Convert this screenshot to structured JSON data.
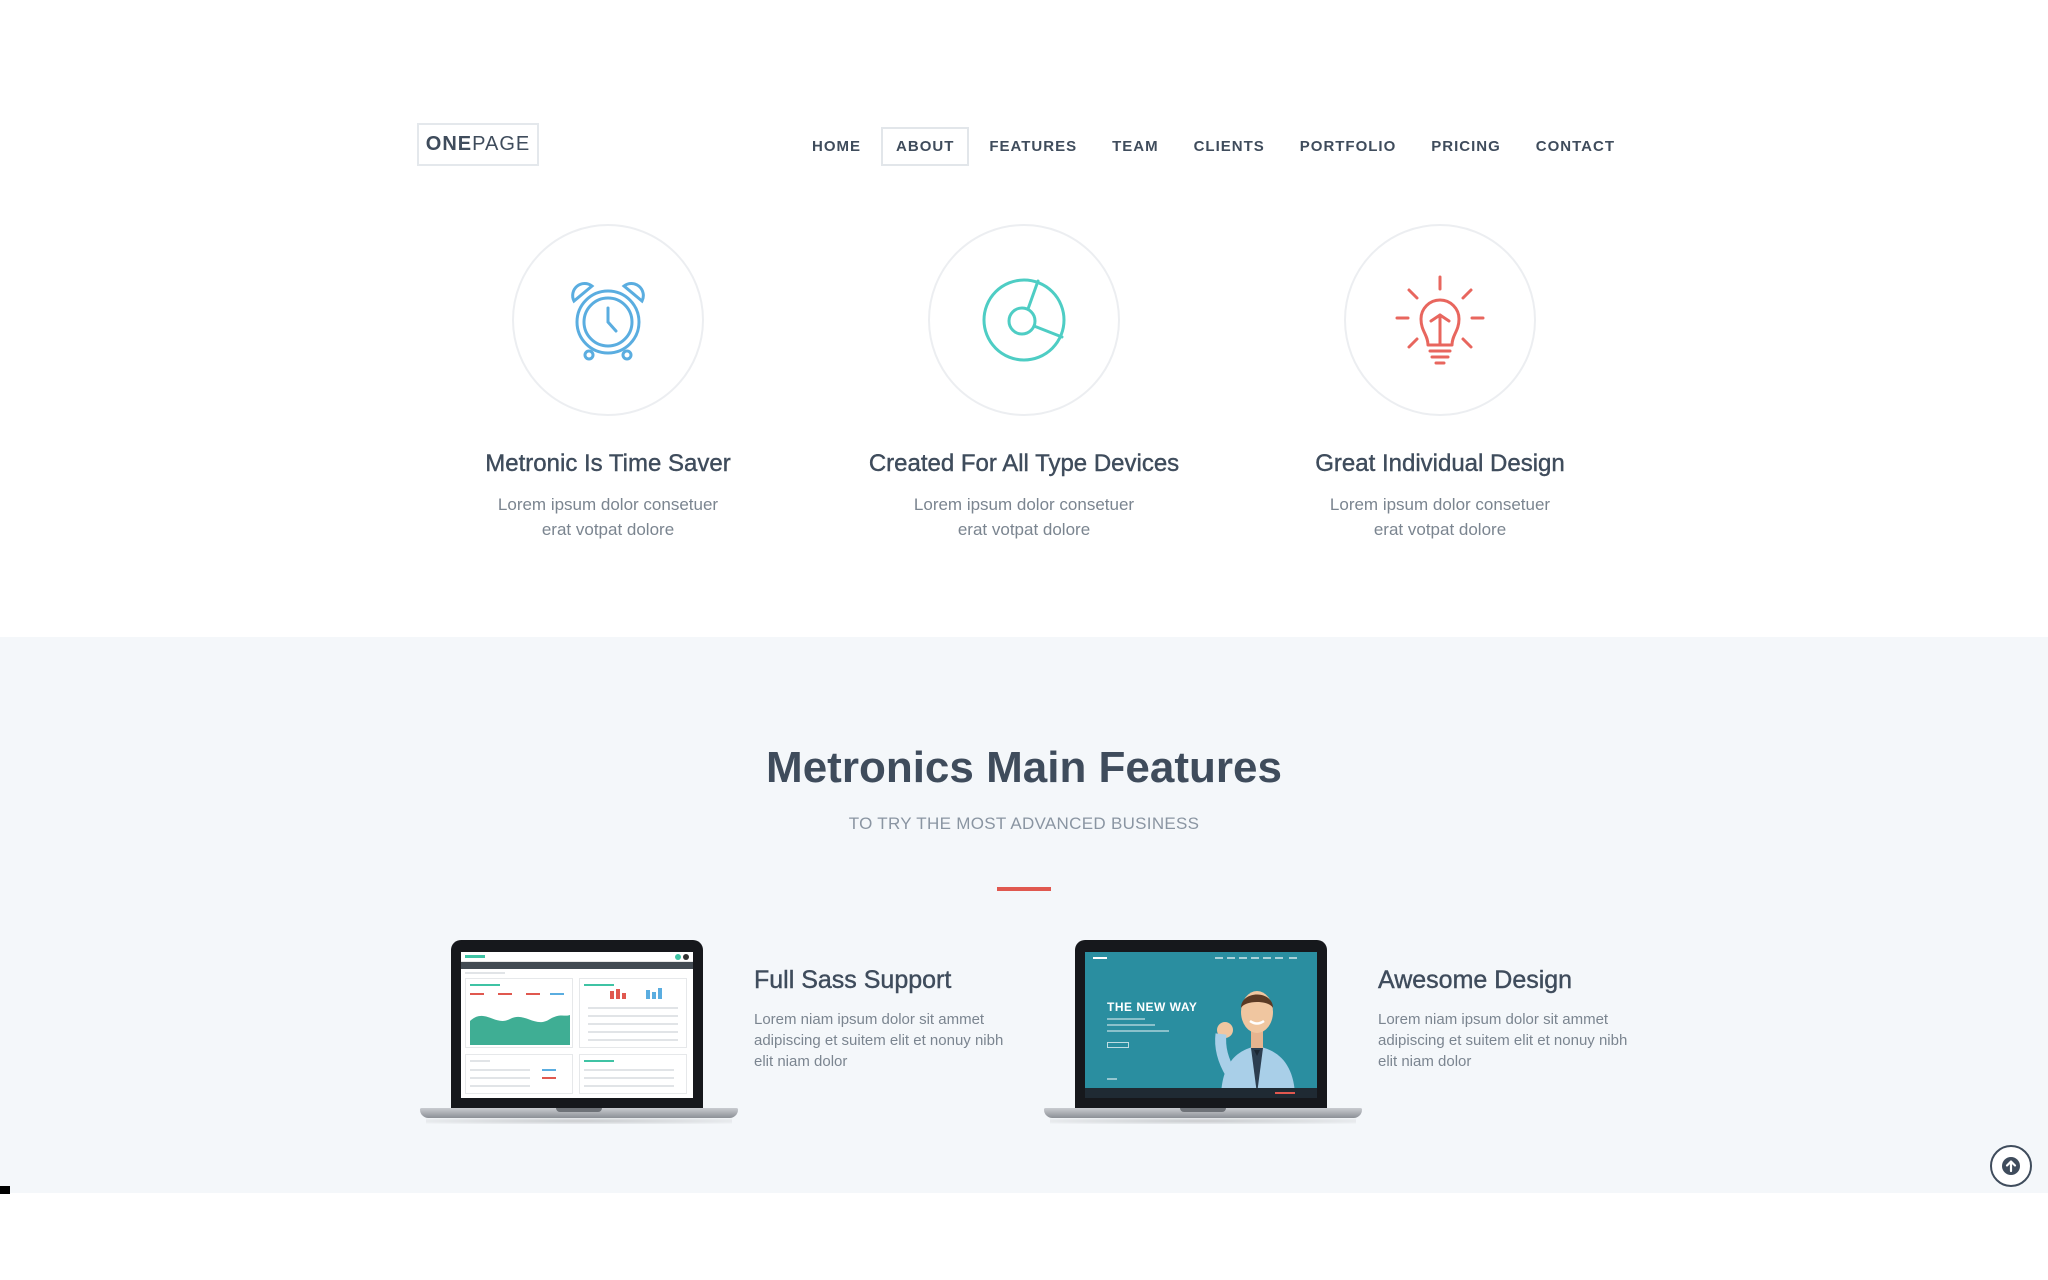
{
  "header": {
    "logo": {
      "bold": "ONE",
      "light": "PAGE"
    },
    "nav": [
      "HOME",
      "ABOUT",
      "FEATURES",
      "TEAM",
      "CLIENTS",
      "PORTFOLIO",
      "PRICING",
      "CONTACT"
    ],
    "active_nav": "ABOUT"
  },
  "services": [
    {
      "icon": "alarm-clock-icon",
      "color": "#5aade0",
      "title": "Metronic Is Time Saver",
      "line1": "Lorem ipsum dolor consetuer",
      "line2": "erat votpat dolore"
    },
    {
      "icon": "pie-chart-icon",
      "color": "#4ecdc4",
      "title": "Created For All Type Devices",
      "line1": "Lorem ipsum dolor consetuer",
      "line2": "erat votpat dolore"
    },
    {
      "icon": "lightbulb-icon",
      "color": "#e8665e",
      "title": "Great Individual Design",
      "line1": "Lorem ipsum dolor consetuer",
      "line2": "erat votpat dolore"
    }
  ],
  "features_section": {
    "title": "Metronics Main Features",
    "subtitle": "TO TRY THE MOST ADVANCED BUSINESS",
    "accent": "#e0584f",
    "items": [
      {
        "title": "Full Sass Support",
        "line1": "Lorem niam ipsum dolor sit ammet",
        "line2": "adipiscing et suitem elit et nonuy nibh",
        "line3": "elit niam dolor"
      },
      {
        "title": "Awesome Design",
        "line1": "Lorem niam ipsum dolor sit ammet",
        "line2": "adipiscing et suitem elit et nonuy nibh",
        "line3": "elit niam dolor",
        "screen_headline": "THE NEW WAY"
      }
    ]
  },
  "scroll_top": {
    "icon": "arrow-up-icon"
  }
}
